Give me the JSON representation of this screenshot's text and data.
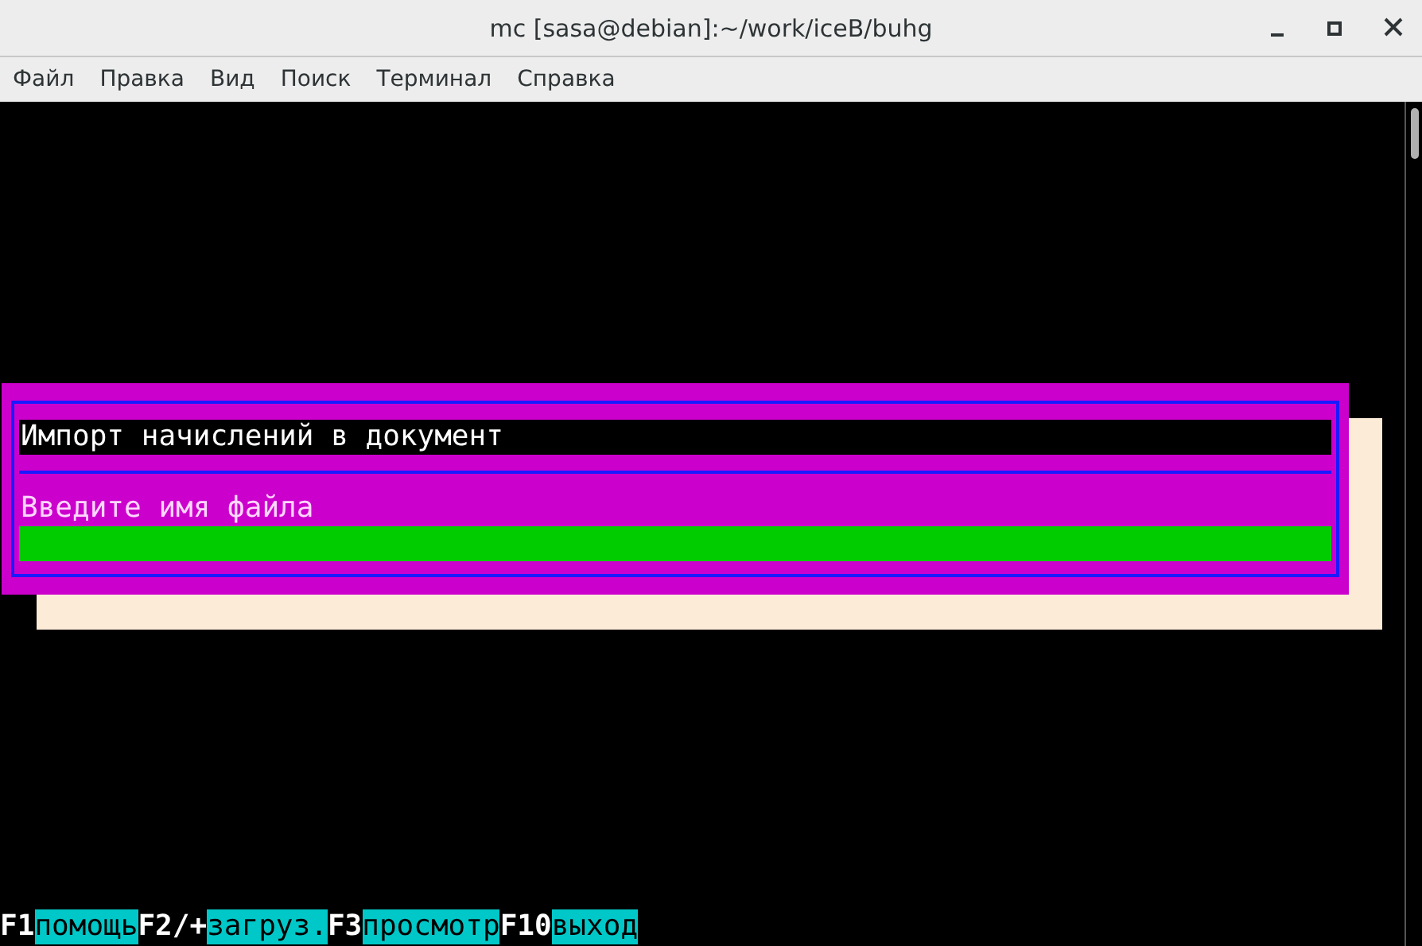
{
  "window": {
    "title": "mc [sasa@debian]:~/work/iceB/buhg"
  },
  "menu": [
    "Файл",
    "Правка",
    "Вид",
    "Поиск",
    "Терминал",
    "Справка"
  ],
  "dialog": {
    "title": "Импорт начислений в документ",
    "prompt": "Введите имя файла"
  },
  "function_keys": [
    {
      "key": "F1",
      "label": "помощь"
    },
    {
      "key": "F2/+",
      "label": "загруз."
    },
    {
      "key": "F3",
      "label": "просмотр"
    },
    {
      "key": "F10",
      "label": "выход"
    }
  ]
}
